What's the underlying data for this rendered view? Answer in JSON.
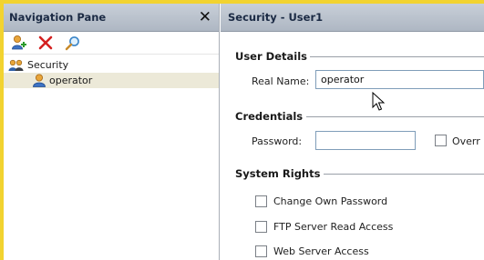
{
  "nav": {
    "title": "Navigation Pane",
    "close_glyph": "✕",
    "toolbar": {
      "add_user_icon": "add-user-icon",
      "delete_icon": "delete-icon",
      "search_icon": "search-icon"
    },
    "tree": {
      "root_label": "Security",
      "child_label": "operator"
    }
  },
  "content": {
    "title": "Security - User1",
    "user_details": {
      "heading": "User Details",
      "real_name_label": "Real Name:",
      "real_name_value": "operator"
    },
    "credentials": {
      "heading": "Credentials",
      "password_label": "Password:",
      "password_value": "",
      "override_label": "Overr"
    },
    "system_rights": {
      "heading": "System Rights",
      "items": [
        {
          "label": "Change Own Password",
          "checked": false
        },
        {
          "label": "FTP Server Read Access",
          "checked": false
        },
        {
          "label": "Web Server Access",
          "checked": false
        }
      ]
    }
  },
  "colors": {
    "frame_accent": "#f2d330",
    "header_bg": "#bcc4cf",
    "selection_bg": "#ece9d8"
  }
}
